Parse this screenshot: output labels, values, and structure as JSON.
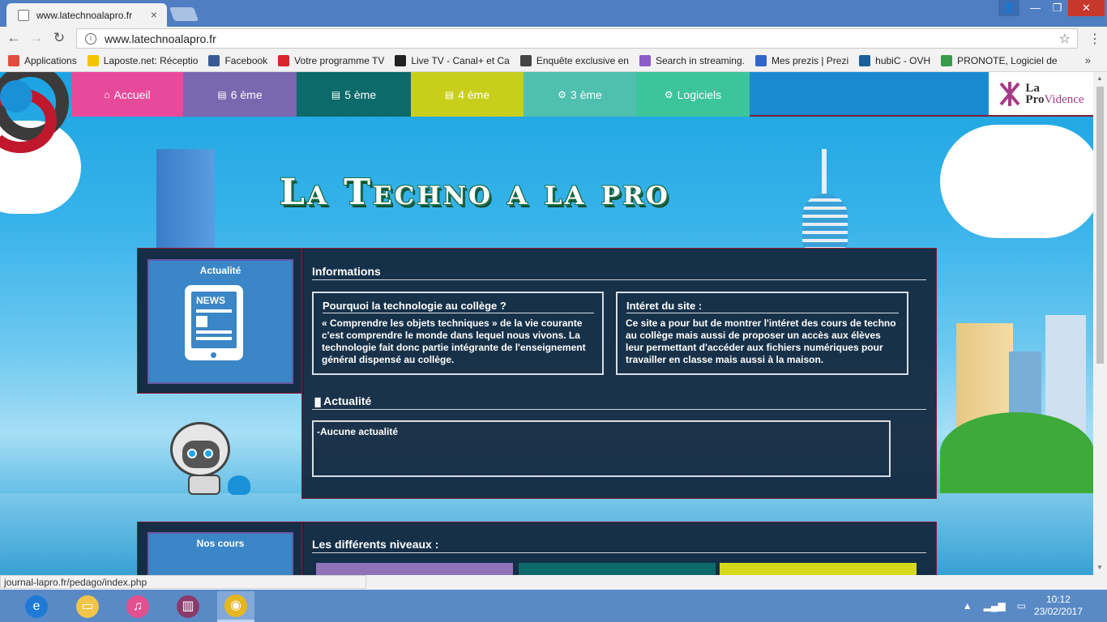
{
  "browser": {
    "tab_title": "www.latechnoalapro.fr",
    "tab_close": "×",
    "url": "www.latechnoalapro.fr",
    "back": "←",
    "forward": "→",
    "reload": "↻",
    "info": "i",
    "star": "☆",
    "menu": "⋮",
    "window": {
      "profile": "👤",
      "minimize": "—",
      "restore": "❐",
      "close": "✕"
    },
    "bookmarks": [
      {
        "label": "Applications",
        "color": "#e34c3c"
      },
      {
        "label": "Laposte.net: Réceptio",
        "color": "#f5c400"
      },
      {
        "label": "Facebook",
        "color": "#3b5998"
      },
      {
        "label": "Votre programme TV",
        "color": "#d8262b"
      },
      {
        "label": "Live TV - Canal+ et Ca",
        "color": "#222222"
      },
      {
        "label": "Enquête exclusive en",
        "color": "#444444"
      },
      {
        "label": "Search in streaming.",
        "color": "#8b5cc8"
      },
      {
        "label": "Mes prezis | Prezi",
        "color": "#3366cc"
      },
      {
        "label": "hubiC - OVH",
        "color": "#1a5e9a"
      },
      {
        "label": "PRONOTE, Logiciel de",
        "color": "#3a9a4a"
      }
    ],
    "bookmarks_more": "»",
    "status_url": "journal-lapro.fr/pedago/index.php"
  },
  "site": {
    "nav": [
      {
        "label": "Accueil",
        "icon": "⌂",
        "color": "#e84a9b",
        "width": 138
      },
      {
        "label": "6 ème",
        "icon": "▤",
        "color": "#7b66b0",
        "width": 140
      },
      {
        "label": "5 ème",
        "icon": "▤",
        "color": "#0d6a6a",
        "width": 141
      },
      {
        "label": "4 ème",
        "icon": "▤",
        "color": "#c8cf1a",
        "width": 139
      },
      {
        "label": "3 ème",
        "icon": "⚙",
        "color": "#4fbfae",
        "width": 139
      },
      {
        "label": "Logiciels",
        "icon": "⚙",
        "color": "#3cc49a",
        "width": 140
      }
    ],
    "logo": {
      "la": "La",
      "pro": "Pro",
      "vidence": "Vidence"
    },
    "title": "La Techno a la pro",
    "sidebar_actualite": "Actualité",
    "news_icon_label": "NEWS",
    "informations_title": "Informations",
    "box1": {
      "title": "Pourquoi la technologie au collège ?",
      "text": "« Comprendre les objets techniques » de la vie courante c'est comprendre le monde dans lequel nous vivons. La technologie fait donc partie intégrante de l'enseignement général dispensé au collège."
    },
    "box2": {
      "title": "Intéret du site :",
      "text": "Ce site a pour but de montrer l'intéret des cours de techno au collège mais aussi de proposer un accès aux élèves leur permettant d'accéder aux fichiers numériques pour travailler en classe mais aussi à la maison."
    },
    "actualite_title": "Actualité",
    "actualite_icon": "▐▌",
    "actualite_text": "-Aucune actualité",
    "nos_cours": "Nos cours",
    "niveaux_title": "Les différents niveaux :",
    "level_colors": [
      "#8f72b8",
      "#0d6a6a",
      "#d8d81a"
    ]
  },
  "taskbar": {
    "apps": [
      {
        "name": "internet-explorer",
        "symbol": "e",
        "color": "#1f7ad6"
      },
      {
        "name": "file-explorer",
        "symbol": "▭",
        "color": "#f1c54a"
      },
      {
        "name": "itunes",
        "symbol": "♫",
        "color": "#e25090"
      },
      {
        "name": "winrar",
        "symbol": "▥",
        "color": "#8a3a6a"
      },
      {
        "name": "chrome",
        "symbol": "◉",
        "color": "#e6b620"
      }
    ],
    "time": "10:12",
    "date": "23/02/2017"
  }
}
